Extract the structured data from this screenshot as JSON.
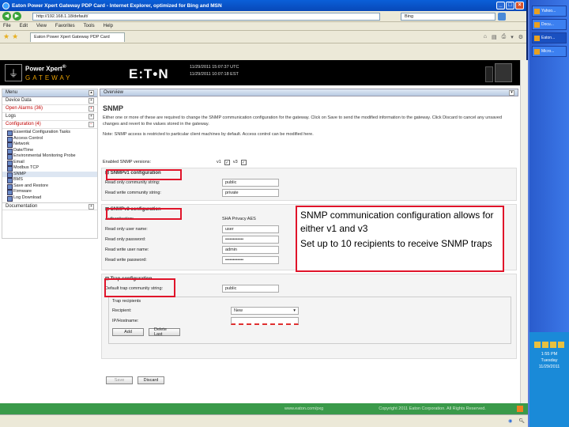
{
  "window": {
    "title": "Eaton Power Xpert Gateway PDP Card - Internet Explorer, optimized for Bing and MSN",
    "address": "http://192.168.1.18/default/",
    "search": "Bing",
    "tab_label": "Eaton Power Xpert Gateway PDP Card"
  },
  "menu": [
    "File",
    "Edit",
    "View",
    "Favorites",
    "Tools",
    "Help"
  ],
  "header": {
    "brand_line1": "Power Xpert",
    "brand_reg": "®",
    "brand_line2": "GATEWAY",
    "logo": "E:T•N",
    "sys_line1": "11/29/2011 15:07:37 UTC",
    "sys_line2": "11/29/2011 10:07:18 EST"
  },
  "nav": {
    "menu_label": "Menu",
    "items": [
      {
        "label": "Device Data",
        "red": false
      },
      {
        "label": "Open Alarms (36)",
        "red": true
      },
      {
        "label": "Logs",
        "red": false
      },
      {
        "label": "Configuration (4)",
        "red": true
      }
    ],
    "subitems": [
      "Essential Configuration Tasks",
      "Access Control",
      "Network",
      "Date/Time",
      "Environmental Monitoring Probe",
      "Email",
      "Modbus TCP",
      "SNMP",
      "BMS",
      "Save and Restore",
      "Firmware",
      "Log Download"
    ],
    "documentation": "Documentation"
  },
  "main": {
    "overview_label": "Overview",
    "title": "SNMP",
    "para1": "Either one or more of these are required to change the SNMP communication configuration for the gateway. Click on Save to send the modified information to the gateway. Click Discard to cancel any unsaved changes and revert to the values stored in the gateway.",
    "para2": "Note: SNMP access is restricted to particular client machines by default. Access control can be modified here.",
    "enabled_versions_label": "Enabled SNMP versions:",
    "v1_label": "v1",
    "v3_label": "v3",
    "v1_section": "SNMPv1 configuration",
    "read_only_community_label": "Read only community string:",
    "read_only_community": "public",
    "read_write_community_label": "Read write community string:",
    "read_write_community": "private",
    "v3_section": "SNMPv3 configuration",
    "auth_label": "Authentication:",
    "auth_value": "SHA Privacy AES",
    "ro_user_label": "Read only user name:",
    "ro_user": "user",
    "ro_pass_label": "Read only password:",
    "ro_pass": "••••••••••••",
    "rw_user_label": "Read write user name:",
    "rw_user": "admin",
    "rw_pass_label": "Read write password:",
    "rw_pass": "••••••••••••",
    "trap_section": "Trap configuration",
    "trap_community_label": "Default trap community string:",
    "trap_community": "public",
    "trap_recipients_label": "Trap recipients",
    "recipient_label": "Recipient:",
    "recipient_value": "New",
    "hostname_label": "IP/Hostname:",
    "add_button": "Add",
    "delete_button": "Delete Last",
    "save_button": "Save",
    "discard_button": "Discard"
  },
  "callout": {
    "line1": "SNMP communication configuration allows for either v1 and v3",
    "line2": "Set up to 10 recipients to receive SNMP traps"
  },
  "footer": {
    "left": "www.eaton.com/pxg",
    "right": "Copyright 2011 Eaton Corporation. All Rights Reserved."
  },
  "taskbar": {
    "items": [
      "Yahoo...",
      "Docu...",
      "Eaton...",
      "Micro..."
    ],
    "time": "1:55 PM",
    "day": "Tuesday",
    "date": "11/29/2011"
  }
}
